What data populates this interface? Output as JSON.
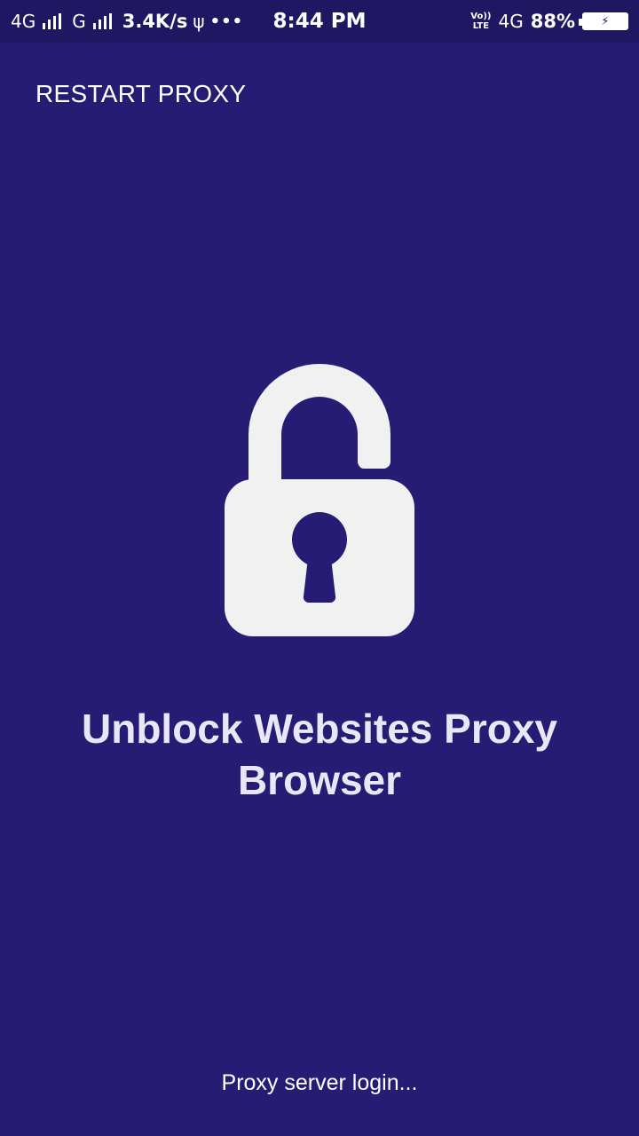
{
  "status_bar": {
    "net1": "4G",
    "net2": "G",
    "speed": "3.4K/s",
    "usb_icon": "usb-icon",
    "more": "•••",
    "time": "8:44 PM",
    "volte_top": "Vo))",
    "volte_bottom": "LTE",
    "net3": "4G",
    "battery_percent": "88%",
    "battery_charging": true
  },
  "toolbar": {
    "restart_label": "RESTART PROXY"
  },
  "main": {
    "icon": "unlocked-padlock-icon",
    "title": "Unblock Websites Proxy Browser",
    "status_message": "Proxy server login..."
  },
  "colors": {
    "background": "#271c73",
    "status_bar": "#1f1761",
    "icon": "#f2f1f2",
    "title": "#e9e7f5"
  }
}
